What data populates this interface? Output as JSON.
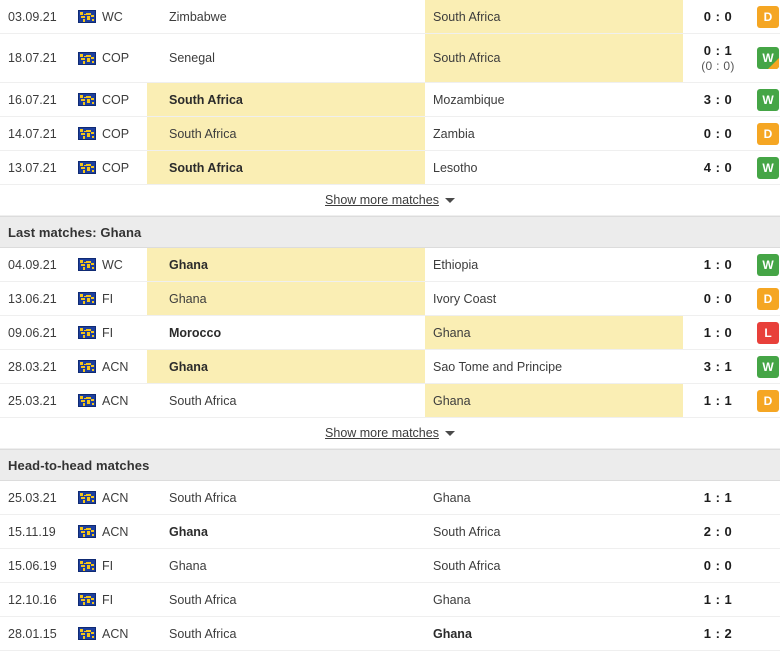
{
  "colors": {
    "highlight": "#faeeb4",
    "header_bg": "#ececec",
    "win": "#45a546",
    "draw": "#f5a623",
    "loss": "#e8403a",
    "icon_bg": "#1d3f9e",
    "icon_fg": "#f5c518"
  },
  "icons": {
    "competition": "world-map-icon",
    "expand": "chevron-down-icon"
  },
  "sections": [
    {
      "id": "last-matches-south-africa",
      "header": null,
      "show_more_label": "Show more matches",
      "rows": [
        {
          "date": "03.09.21",
          "competition": "WC",
          "home": "Zimbabwe",
          "away": "South Africa",
          "home_bold": false,
          "away_bold": false,
          "home_highlight": false,
          "away_highlight": true,
          "score": "0 : 0",
          "halftime": null,
          "result": "D"
        },
        {
          "date": "18.07.21",
          "competition": "COP",
          "home": "Senegal",
          "away": "South Africa",
          "home_bold": false,
          "away_bold": false,
          "home_highlight": false,
          "away_highlight": true,
          "score": "0 : 1",
          "halftime": "(0 : 0)",
          "result": "W",
          "result_penalty": true
        },
        {
          "date": "16.07.21",
          "competition": "COP",
          "home": "South Africa",
          "away": "Mozambique",
          "home_bold": true,
          "away_bold": false,
          "home_highlight": true,
          "away_highlight": false,
          "score": "3 : 0",
          "halftime": null,
          "result": "W"
        },
        {
          "date": "14.07.21",
          "competition": "COP",
          "home": "South Africa",
          "away": "Zambia",
          "home_bold": false,
          "away_bold": false,
          "home_highlight": true,
          "away_highlight": false,
          "score": "0 : 0",
          "halftime": null,
          "result": "D"
        },
        {
          "date": "13.07.21",
          "competition": "COP",
          "home": "South Africa",
          "away": "Lesotho",
          "home_bold": true,
          "away_bold": false,
          "home_highlight": true,
          "away_highlight": false,
          "score": "4 : 0",
          "halftime": null,
          "result": "W"
        }
      ]
    },
    {
      "id": "last-matches-ghana",
      "header": "Last matches: Ghana",
      "show_more_label": "Show more matches",
      "rows": [
        {
          "date": "04.09.21",
          "competition": "WC",
          "home": "Ghana",
          "away": "Ethiopia",
          "home_bold": true,
          "away_bold": false,
          "home_highlight": true,
          "away_highlight": false,
          "score": "1 : 0",
          "halftime": null,
          "result": "W"
        },
        {
          "date": "13.06.21",
          "competition": "FI",
          "home": "Ghana",
          "away": "Ivory Coast",
          "home_bold": false,
          "away_bold": false,
          "home_highlight": true,
          "away_highlight": false,
          "score": "0 : 0",
          "halftime": null,
          "result": "D"
        },
        {
          "date": "09.06.21",
          "competition": "FI",
          "home": "Morocco",
          "away": "Ghana",
          "home_bold": true,
          "away_bold": false,
          "home_highlight": false,
          "away_highlight": true,
          "score": "1 : 0",
          "halftime": null,
          "result": "L"
        },
        {
          "date": "28.03.21",
          "competition": "ACN",
          "home": "Ghana",
          "away": "Sao Tome and Principe",
          "home_bold": true,
          "away_bold": false,
          "home_highlight": true,
          "away_highlight": false,
          "score": "3 : 1",
          "halftime": null,
          "result": "W"
        },
        {
          "date": "25.03.21",
          "competition": "ACN",
          "home": "South Africa",
          "away": "Ghana",
          "home_bold": false,
          "away_bold": false,
          "home_highlight": false,
          "away_highlight": true,
          "score": "1 : 1",
          "halftime": null,
          "result": "D"
        }
      ]
    },
    {
      "id": "head-to-head-matches",
      "header": "Head-to-head matches",
      "show_more_label": null,
      "rows": [
        {
          "date": "25.03.21",
          "competition": "ACN",
          "home": "South Africa",
          "away": "Ghana",
          "home_bold": false,
          "away_bold": false,
          "home_highlight": false,
          "away_highlight": false,
          "score": "1 : 1",
          "halftime": null,
          "result": null
        },
        {
          "date": "15.11.19",
          "competition": "ACN",
          "home": "Ghana",
          "away": "South Africa",
          "home_bold": true,
          "away_bold": false,
          "home_highlight": false,
          "away_highlight": false,
          "score": "2 : 0",
          "halftime": null,
          "result": null
        },
        {
          "date": "15.06.19",
          "competition": "FI",
          "home": "Ghana",
          "away": "South Africa",
          "home_bold": false,
          "away_bold": false,
          "home_highlight": false,
          "away_highlight": false,
          "score": "0 : 0",
          "halftime": null,
          "result": null
        },
        {
          "date": "12.10.16",
          "competition": "FI",
          "home": "South Africa",
          "away": "Ghana",
          "home_bold": false,
          "away_bold": false,
          "home_highlight": false,
          "away_highlight": false,
          "score": "1 : 1",
          "halftime": null,
          "result": null
        },
        {
          "date": "28.01.15",
          "competition": "ACN",
          "home": "South Africa",
          "away": "Ghana",
          "home_bold": false,
          "away_bold": true,
          "home_highlight": false,
          "away_highlight": false,
          "score": "1 : 2",
          "halftime": null,
          "result": null
        }
      ]
    }
  ]
}
